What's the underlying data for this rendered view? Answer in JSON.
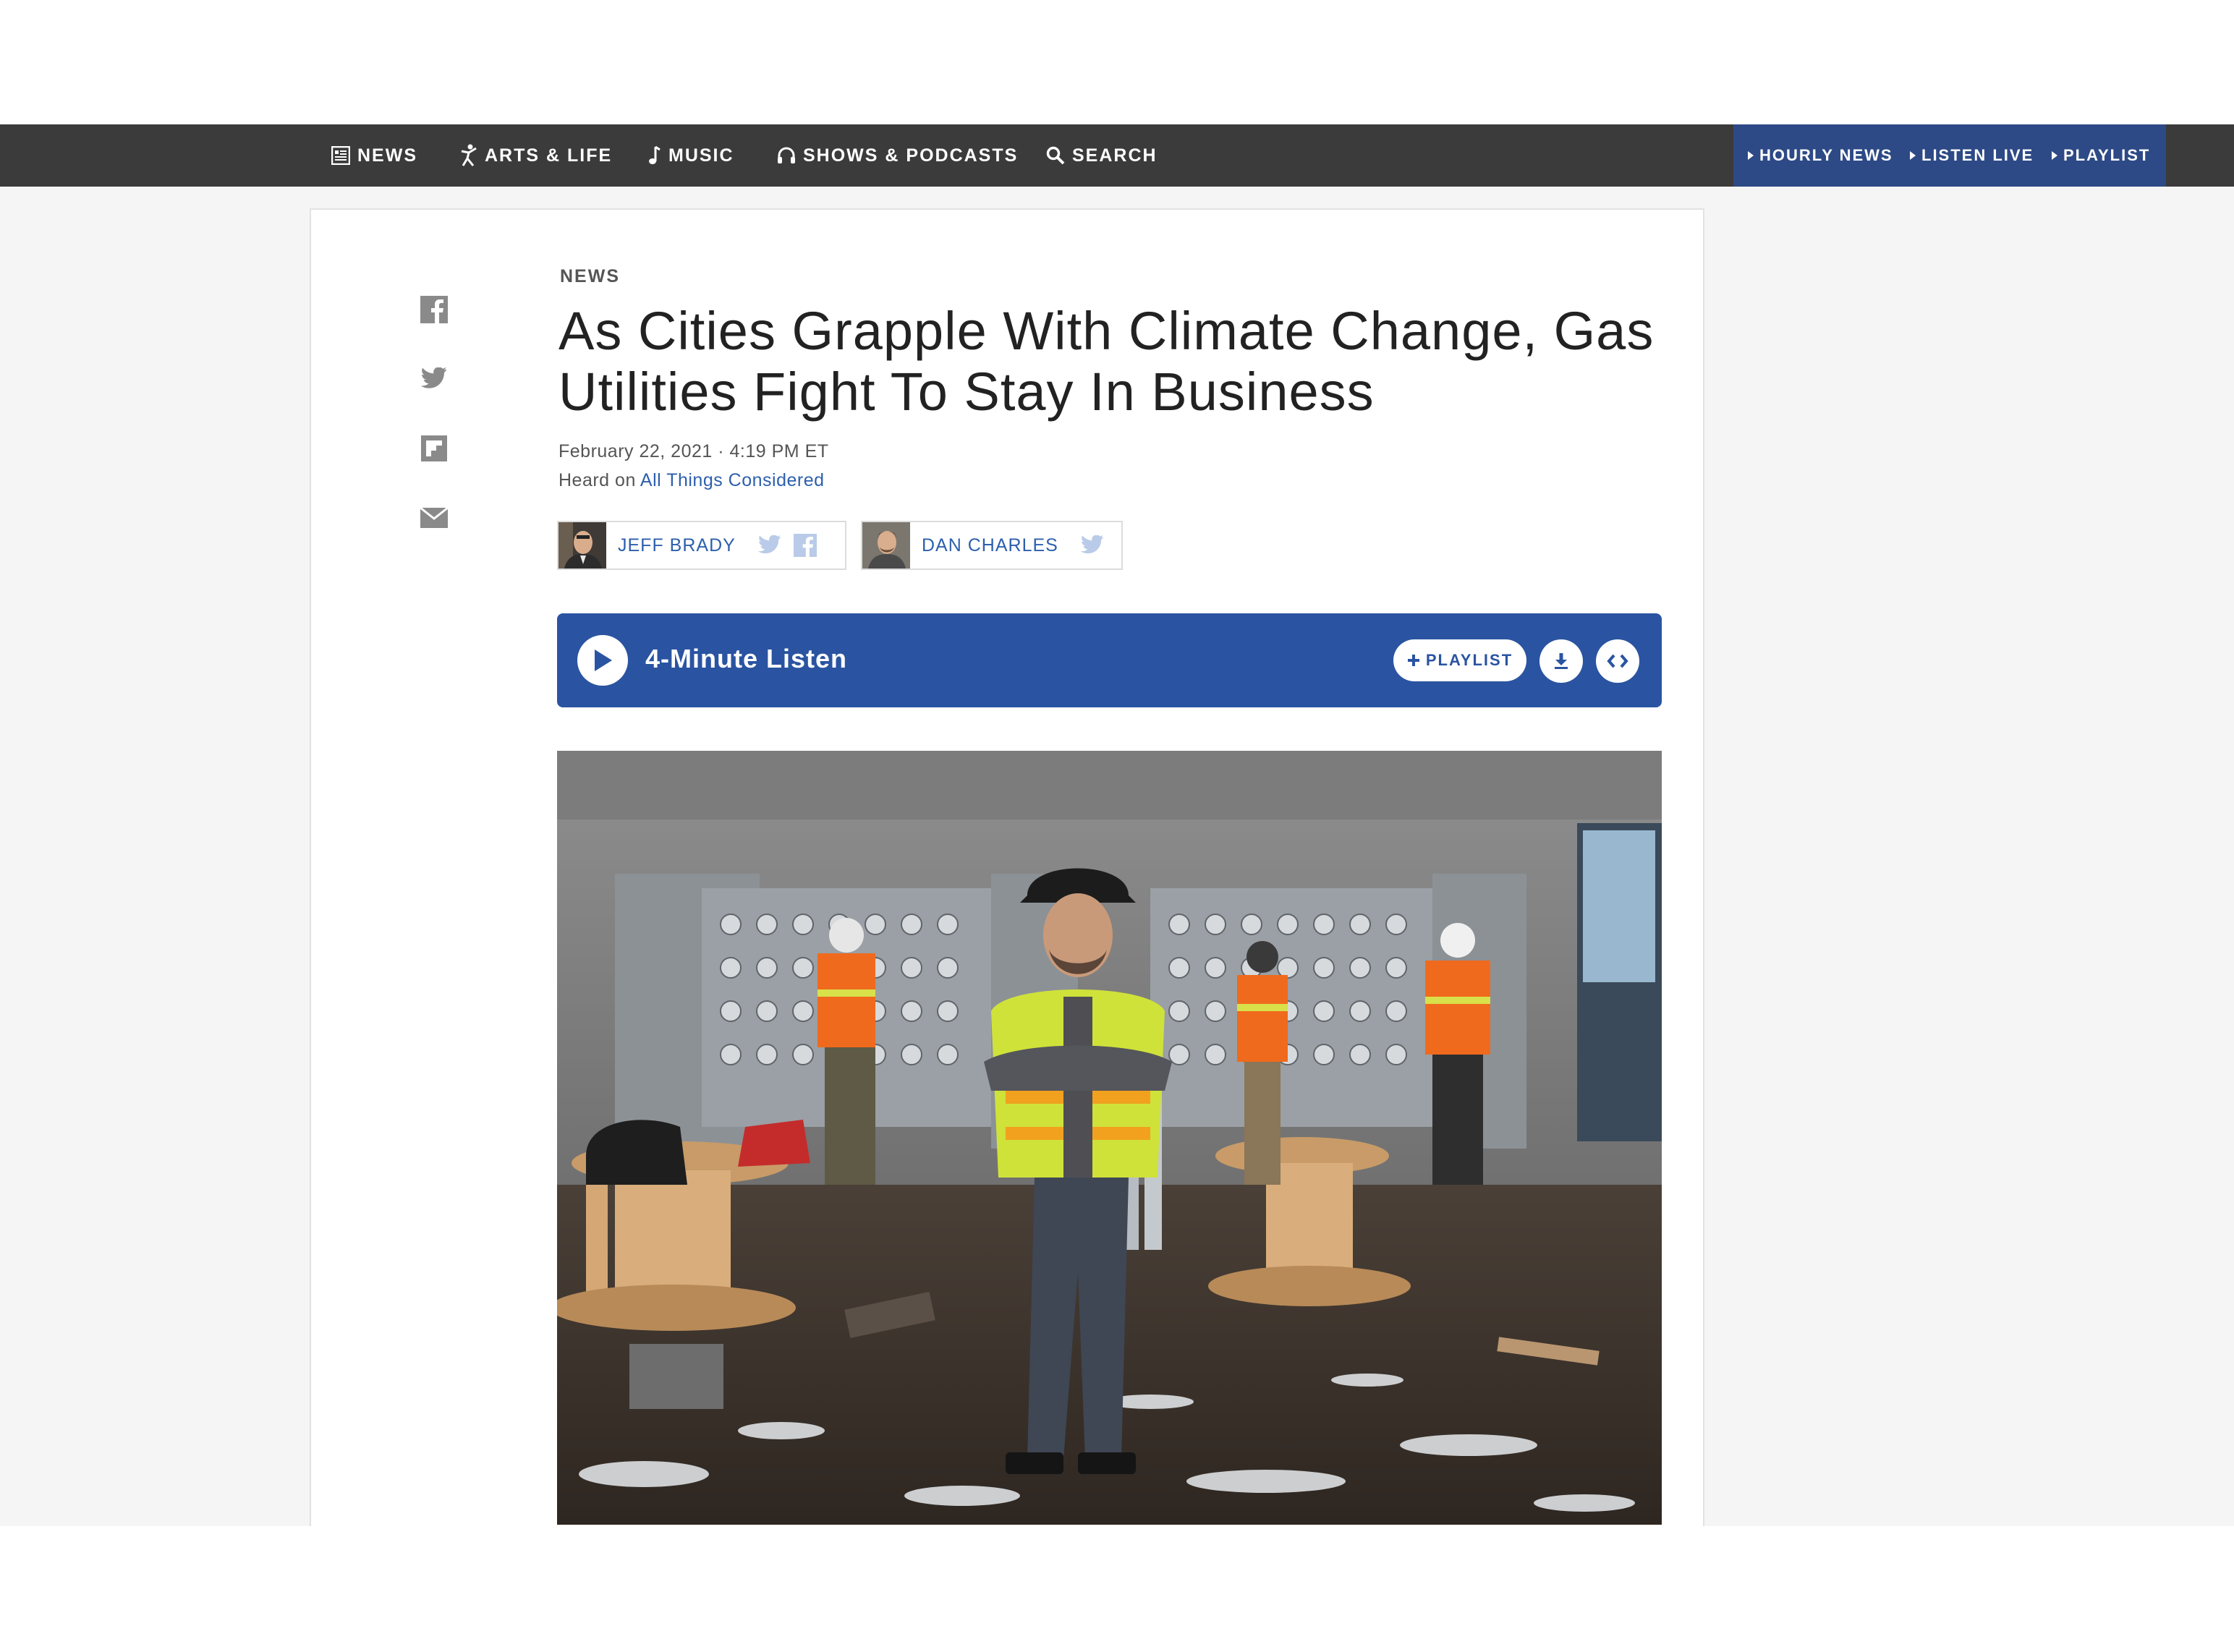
{
  "nav": {
    "items": [
      {
        "label": "NEWS",
        "icon": "news-icon"
      },
      {
        "label": "ARTS & LIFE",
        "icon": "arts-icon"
      },
      {
        "label": "MUSIC",
        "icon": "music-icon"
      },
      {
        "label": "SHOWS & PODCASTS",
        "icon": "headphones-icon"
      },
      {
        "label": "SEARCH",
        "icon": "search-icon"
      }
    ],
    "station_links": [
      "HOURLY NEWS",
      "LISTEN LIVE",
      "PLAYLIST"
    ]
  },
  "share": [
    "facebook-icon",
    "twitter-icon",
    "flipboard-icon",
    "email-icon"
  ],
  "article": {
    "kicker": "NEWS",
    "headline": "As Cities Grapple With Climate Change, Gas Utilities Fight To Stay In Business",
    "dateline": "February 22, 2021 · 4:19 PM ET",
    "heard_prefix": "Heard on ",
    "heard_show": "All Things Considered",
    "bylines": [
      {
        "name": "JEFF BRADY",
        "icons": [
          "twitter-icon",
          "facebook-icon"
        ]
      },
      {
        "name": "DAN CHARLES",
        "icons": [
          "twitter-icon"
        ]
      }
    ]
  },
  "player": {
    "label": "4-Minute Listen",
    "playlist_label": "PLAYLIST"
  },
  "colors": {
    "topbar": "#3b3b3b",
    "station_box": "#2d4a86",
    "player": "#2a54a1",
    "link": "#2d5fad"
  }
}
